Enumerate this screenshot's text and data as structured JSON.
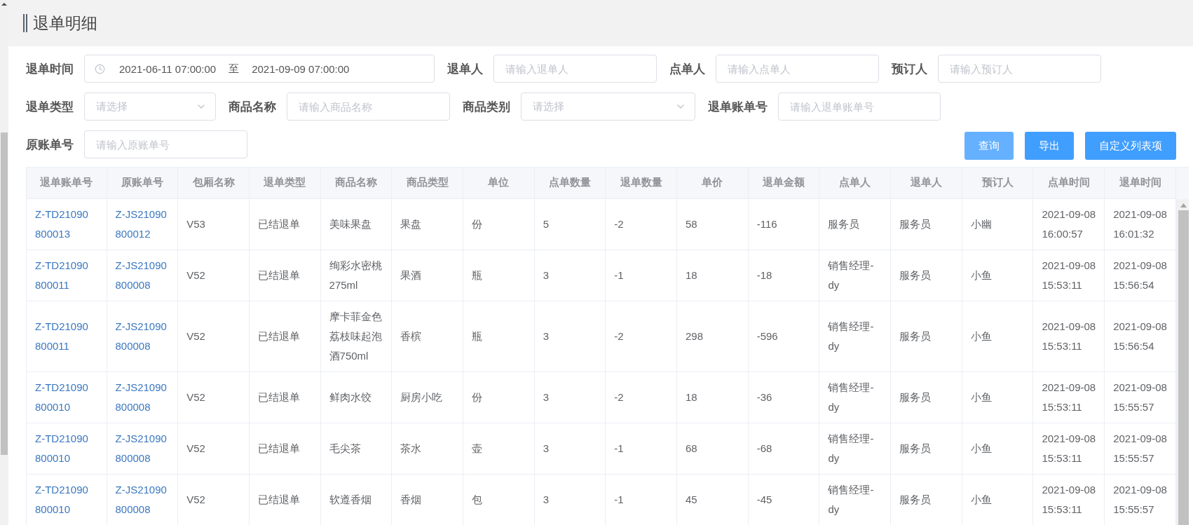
{
  "page": {
    "title": "退单明细"
  },
  "filters": {
    "groups": [
      {
        "fields": [
          {
            "kind": "date_range",
            "label": "退单时间",
            "start": "2021-06-11 07:00:00",
            "separator": "至",
            "end": "2021-09-09 07:00:00"
          },
          {
            "kind": "text",
            "label": "退单人",
            "placeholder": "请输入退单人"
          },
          {
            "kind": "text",
            "label": "点单人",
            "placeholder": "请输入点单人"
          },
          {
            "kind": "text",
            "label": "预订人",
            "placeholder": "请输入预订人"
          }
        ]
      },
      {
        "fields": [
          {
            "kind": "select",
            "label": "退单类型",
            "placeholder": "请选择"
          },
          {
            "kind": "text",
            "label": "商品名称",
            "placeholder": "请输入商品名称"
          },
          {
            "kind": "select",
            "label": "商品类别",
            "placeholder": "请选择"
          },
          {
            "kind": "text",
            "label": "退单账单号",
            "placeholder": "请输入退单账单号"
          }
        ]
      },
      {
        "fields": [
          {
            "kind": "text",
            "label": "原账单号",
            "placeholder": "请输入原账单号"
          }
        ]
      }
    ],
    "buttons": [
      {
        "label": "查询",
        "disabled": true
      },
      {
        "label": "导出",
        "disabled": false
      },
      {
        "label": "自定义列表项",
        "disabled": false
      }
    ]
  },
  "table": {
    "columns": [
      {
        "label": "退单账单号",
        "kind": "link"
      },
      {
        "label": "原账单号",
        "kind": "link"
      },
      {
        "label": "包厢名称",
        "kind": "text"
      },
      {
        "label": "退单类型",
        "kind": "text"
      },
      {
        "label": "商品名称",
        "kind": "text"
      },
      {
        "label": "商品类型",
        "kind": "text"
      },
      {
        "label": "单位",
        "kind": "text"
      },
      {
        "label": "点单数量",
        "kind": "text"
      },
      {
        "label": "退单数量",
        "kind": "text"
      },
      {
        "label": "单价",
        "kind": "text"
      },
      {
        "label": "退单金额",
        "kind": "text"
      },
      {
        "label": "点单人",
        "kind": "text"
      },
      {
        "label": "退单人",
        "kind": "text"
      },
      {
        "label": "预订人",
        "kind": "text"
      },
      {
        "label": "点单时间",
        "kind": "time"
      },
      {
        "label": "退单时间",
        "kind": "time"
      }
    ],
    "rows": [
      [
        "Z-TD21090800013",
        "Z-JS21090800012",
        "V53",
        "已结退单",
        "美味果盘",
        "果盘",
        "份",
        "5",
        "-2",
        "58",
        "-116",
        "服务员",
        "服务员",
        "小幽",
        "2021-09-08 16:00:57",
        "2021-09-08 16:01:32"
      ],
      [
        "Z-TD21090800011",
        "Z-JS21090800008",
        "V52",
        "已结退单",
        "绚彩水密桃275ml",
        "果酒",
        "瓶",
        "3",
        "-1",
        "18",
        "-18",
        "销售经理-dy",
        "服务员",
        "小鱼",
        "2021-09-08 15:53:11",
        "2021-09-08 15:56:54"
      ],
      [
        "Z-TD21090800011",
        "Z-JS21090800008",
        "V52",
        "已结退单",
        "摩卡菲金色荔枝味起泡酒750ml",
        "香槟",
        "瓶",
        "3",
        "-2",
        "298",
        "-596",
        "销售经理-dy",
        "服务员",
        "小鱼",
        "2021-09-08 15:53:11",
        "2021-09-08 15:56:54"
      ],
      [
        "Z-TD21090800010",
        "Z-JS21090800008",
        "V52",
        "已结退单",
        "鲜肉水饺",
        "厨房小吃",
        "份",
        "3",
        "-2",
        "18",
        "-36",
        "销售经理-dy",
        "服务员",
        "小鱼",
        "2021-09-08 15:53:11",
        "2021-09-08 15:55:57"
      ],
      [
        "Z-TD21090800010",
        "Z-JS21090800008",
        "V52",
        "已结退单",
        "毛尖茶",
        "茶水",
        "壶",
        "3",
        "-1",
        "68",
        "-68",
        "销售经理-dy",
        "服务员",
        "小鱼",
        "2021-09-08 15:53:11",
        "2021-09-08 15:55:57"
      ],
      [
        "Z-TD21090800010",
        "Z-JS21090800008",
        "V52",
        "已结退单",
        "软遵香烟",
        "香烟",
        "包",
        "3",
        "-1",
        "45",
        "-45",
        "销售经理-dy",
        "服务员",
        "小鱼",
        "2021-09-08 15:53:11",
        "2021-09-08 15:55:57"
      ]
    ]
  }
}
